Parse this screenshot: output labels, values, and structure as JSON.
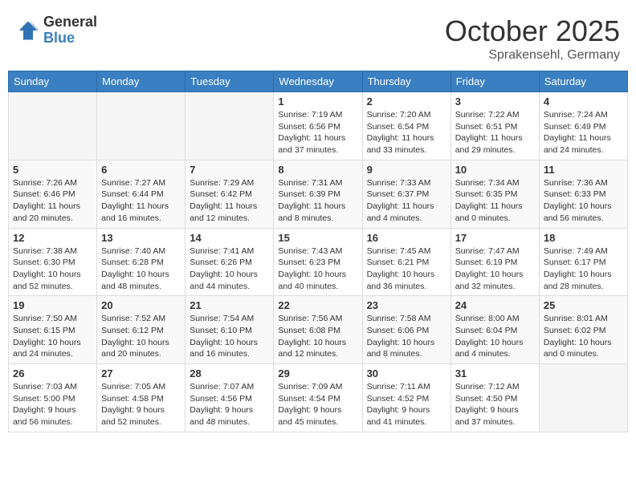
{
  "logo": {
    "general": "General",
    "blue": "Blue"
  },
  "title": "October 2025",
  "location": "Sprakensehl, Germany",
  "weekdays": [
    "Sunday",
    "Monday",
    "Tuesday",
    "Wednesday",
    "Thursday",
    "Friday",
    "Saturday"
  ],
  "weeks": [
    [
      {
        "day": "",
        "info": ""
      },
      {
        "day": "",
        "info": ""
      },
      {
        "day": "",
        "info": ""
      },
      {
        "day": "1",
        "info": "Sunrise: 7:19 AM\nSunset: 6:56 PM\nDaylight: 11 hours\nand 37 minutes."
      },
      {
        "day": "2",
        "info": "Sunrise: 7:20 AM\nSunset: 6:54 PM\nDaylight: 11 hours\nand 33 minutes."
      },
      {
        "day": "3",
        "info": "Sunrise: 7:22 AM\nSunset: 6:51 PM\nDaylight: 11 hours\nand 29 minutes."
      },
      {
        "day": "4",
        "info": "Sunrise: 7:24 AM\nSunset: 6:49 PM\nDaylight: 11 hours\nand 24 minutes."
      }
    ],
    [
      {
        "day": "5",
        "info": "Sunrise: 7:26 AM\nSunset: 6:46 PM\nDaylight: 11 hours\nand 20 minutes."
      },
      {
        "day": "6",
        "info": "Sunrise: 7:27 AM\nSunset: 6:44 PM\nDaylight: 11 hours\nand 16 minutes."
      },
      {
        "day": "7",
        "info": "Sunrise: 7:29 AM\nSunset: 6:42 PM\nDaylight: 11 hours\nand 12 minutes."
      },
      {
        "day": "8",
        "info": "Sunrise: 7:31 AM\nSunset: 6:39 PM\nDaylight: 11 hours\nand 8 minutes."
      },
      {
        "day": "9",
        "info": "Sunrise: 7:33 AM\nSunset: 6:37 PM\nDaylight: 11 hours\nand 4 minutes."
      },
      {
        "day": "10",
        "info": "Sunrise: 7:34 AM\nSunset: 6:35 PM\nDaylight: 11 hours\nand 0 minutes."
      },
      {
        "day": "11",
        "info": "Sunrise: 7:36 AM\nSunset: 6:33 PM\nDaylight: 10 hours\nand 56 minutes."
      }
    ],
    [
      {
        "day": "12",
        "info": "Sunrise: 7:38 AM\nSunset: 6:30 PM\nDaylight: 10 hours\nand 52 minutes."
      },
      {
        "day": "13",
        "info": "Sunrise: 7:40 AM\nSunset: 6:28 PM\nDaylight: 10 hours\nand 48 minutes."
      },
      {
        "day": "14",
        "info": "Sunrise: 7:41 AM\nSunset: 6:26 PM\nDaylight: 10 hours\nand 44 minutes."
      },
      {
        "day": "15",
        "info": "Sunrise: 7:43 AM\nSunset: 6:23 PM\nDaylight: 10 hours\nand 40 minutes."
      },
      {
        "day": "16",
        "info": "Sunrise: 7:45 AM\nSunset: 6:21 PM\nDaylight: 10 hours\nand 36 minutes."
      },
      {
        "day": "17",
        "info": "Sunrise: 7:47 AM\nSunset: 6:19 PM\nDaylight: 10 hours\nand 32 minutes."
      },
      {
        "day": "18",
        "info": "Sunrise: 7:49 AM\nSunset: 6:17 PM\nDaylight: 10 hours\nand 28 minutes."
      }
    ],
    [
      {
        "day": "19",
        "info": "Sunrise: 7:50 AM\nSunset: 6:15 PM\nDaylight: 10 hours\nand 24 minutes."
      },
      {
        "day": "20",
        "info": "Sunrise: 7:52 AM\nSunset: 6:12 PM\nDaylight: 10 hours\nand 20 minutes."
      },
      {
        "day": "21",
        "info": "Sunrise: 7:54 AM\nSunset: 6:10 PM\nDaylight: 10 hours\nand 16 minutes."
      },
      {
        "day": "22",
        "info": "Sunrise: 7:56 AM\nSunset: 6:08 PM\nDaylight: 10 hours\nand 12 minutes."
      },
      {
        "day": "23",
        "info": "Sunrise: 7:58 AM\nSunset: 6:06 PM\nDaylight: 10 hours\nand 8 minutes."
      },
      {
        "day": "24",
        "info": "Sunrise: 8:00 AM\nSunset: 6:04 PM\nDaylight: 10 hours\nand 4 minutes."
      },
      {
        "day": "25",
        "info": "Sunrise: 8:01 AM\nSunset: 6:02 PM\nDaylight: 10 hours\nand 0 minutes."
      }
    ],
    [
      {
        "day": "26",
        "info": "Sunrise: 7:03 AM\nSunset: 5:00 PM\nDaylight: 9 hours\nand 56 minutes."
      },
      {
        "day": "27",
        "info": "Sunrise: 7:05 AM\nSunset: 4:58 PM\nDaylight: 9 hours\nand 52 minutes."
      },
      {
        "day": "28",
        "info": "Sunrise: 7:07 AM\nSunset: 4:56 PM\nDaylight: 9 hours\nand 48 minutes."
      },
      {
        "day": "29",
        "info": "Sunrise: 7:09 AM\nSunset: 4:54 PM\nDaylight: 9 hours\nand 45 minutes."
      },
      {
        "day": "30",
        "info": "Sunrise: 7:11 AM\nSunset: 4:52 PM\nDaylight: 9 hours\nand 41 minutes."
      },
      {
        "day": "31",
        "info": "Sunrise: 7:12 AM\nSunset: 4:50 PM\nDaylight: 9 hours\nand 37 minutes."
      },
      {
        "day": "",
        "info": ""
      }
    ]
  ]
}
